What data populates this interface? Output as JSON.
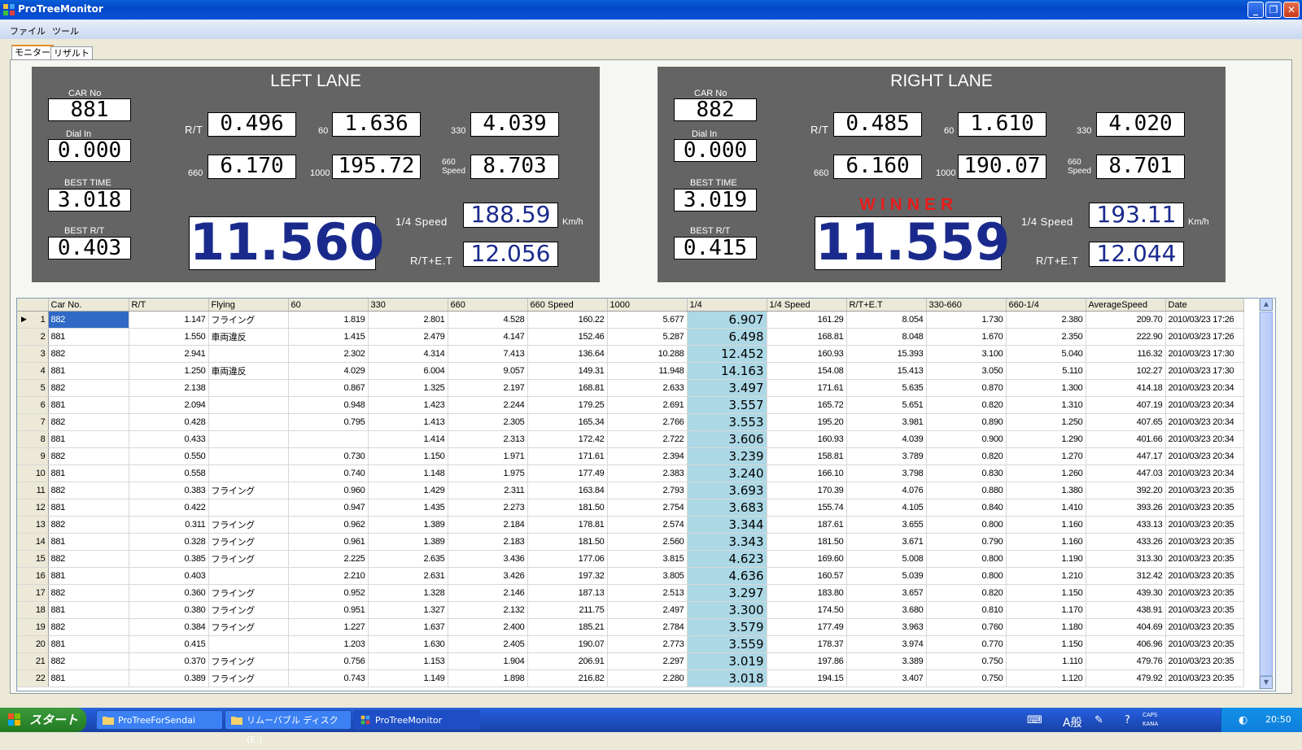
{
  "window": {
    "title": "ProTreeMonitor"
  },
  "menu": [
    "ファイル",
    "ツール"
  ],
  "tabs": [
    "モニター",
    "リザルト"
  ],
  "labels": {
    "car_no": "CAR No",
    "dial_in": "Dial In",
    "best_time": "BEST TIME",
    "best_rt": "BEST R/T",
    "rt": "R/T",
    "s60": "60",
    "s330": "330",
    "s660": "660",
    "s1000": "1000",
    "s660speed_1": "660",
    "s660speed_2": "Speed",
    "quarter_speed": "1/4 Speed",
    "kmh": "Km/h",
    "rt_et": "R/T+E.T"
  },
  "left_lane": {
    "title": "LEFT LANE",
    "car_no": "881",
    "dial_in": "0.000",
    "best_time": "3.018",
    "best_rt": "0.403",
    "rt": "0.496",
    "t60": "1.636",
    "t330": "4.039",
    "t660": "6.170",
    "t1000": "195.72",
    "t660speed": "8.703",
    "et": "11.560",
    "quarter_speed": "188.59",
    "rt_et": "12.056",
    "winner": ""
  },
  "right_lane": {
    "title": "RIGHT LANE",
    "car_no": "882",
    "dial_in": "0.000",
    "best_time": "3.019",
    "best_rt": "0.415",
    "rt": "0.485",
    "t60": "1.610",
    "t330": "4.020",
    "t660": "6.160",
    "t1000": "190.07",
    "t660speed": "8.701",
    "et": "11.559",
    "quarter_speed": "193.11",
    "rt_et": "12.044",
    "winner": "WINNER"
  },
  "grid": {
    "columns": [
      "Car No.",
      "R/T",
      "Flying",
      "60",
      "330",
      "660",
      "660 Speed",
      "1000",
      "1/4",
      "1/4 Speed",
      "R/T+E.T",
      "330-660",
      "660-1/4",
      "AverageSpeed",
      "Date"
    ],
    "rows": [
      [
        "1",
        "882",
        "1.147",
        "フライング",
        "1.819",
        "2.801",
        "4.528",
        "160.22",
        "5.677",
        "6.907",
        "161.29",
        "8.054",
        "1.730",
        "2.380",
        "209.70",
        "2010/03/23 17:26"
      ],
      [
        "2",
        "881",
        "1.550",
        "車両違反",
        "1.415",
        "2.479",
        "4.147",
        "152.46",
        "5.287",
        "6.498",
        "168.81",
        "8.048",
        "1.670",
        "2.350",
        "222.90",
        "2010/03/23 17:26"
      ],
      [
        "3",
        "882",
        "2.941",
        "",
        "2.302",
        "4.314",
        "7.413",
        "136.64",
        "10.288",
        "12.452",
        "160.93",
        "15.393",
        "3.100",
        "5.040",
        "116.32",
        "2010/03/23 17:30"
      ],
      [
        "4",
        "881",
        "1.250",
        "車両違反",
        "4.029",
        "6.004",
        "9.057",
        "149.31",
        "11.948",
        "14.163",
        "154.08",
        "15.413",
        "3.050",
        "5.110",
        "102.27",
        "2010/03/23 17:30"
      ],
      [
        "5",
        "882",
        "2.138",
        "",
        "0.867",
        "1.325",
        "2.197",
        "168.81",
        "2.633",
        "3.497",
        "171.61",
        "5.635",
        "0.870",
        "1.300",
        "414.18",
        "2010/03/23 20:34"
      ],
      [
        "6",
        "881",
        "2.094",
        "",
        "0.948",
        "1.423",
        "2.244",
        "179.25",
        "2.691",
        "3.557",
        "165.72",
        "5.651",
        "0.820",
        "1.310",
        "407.19",
        "2010/03/23 20:34"
      ],
      [
        "7",
        "882",
        "0.428",
        "",
        "0.795",
        "1.413",
        "2.305",
        "165.34",
        "2.766",
        "3.553",
        "195.20",
        "3.981",
        "0.890",
        "1.250",
        "407.65",
        "2010/03/23 20:34"
      ],
      [
        "8",
        "881",
        "0.433",
        "",
        "",
        "1.414",
        "2.313",
        "172.42",
        "2.722",
        "3.606",
        "160.93",
        "4.039",
        "0.900",
        "1.290",
        "401.66",
        "2010/03/23 20:34"
      ],
      [
        "9",
        "882",
        "0.550",
        "",
        "0.730",
        "1.150",
        "1.971",
        "171.61",
        "2.394",
        "3.239",
        "158.81",
        "3.789",
        "0.820",
        "1.270",
        "447.17",
        "2010/03/23 20:34"
      ],
      [
        "10",
        "881",
        "0.558",
        "",
        "0.740",
        "1.148",
        "1.975",
        "177.49",
        "2.383",
        "3.240",
        "166.10",
        "3.798",
        "0.830",
        "1.260",
        "447.03",
        "2010/03/23 20:34"
      ],
      [
        "11",
        "882",
        "0.383",
        "フライング",
        "0.960",
        "1.429",
        "2.311",
        "163.84",
        "2.793",
        "3.693",
        "170.39",
        "4.076",
        "0.880",
        "1.380",
        "392.20",
        "2010/03/23 20:35"
      ],
      [
        "12",
        "881",
        "0.422",
        "",
        "0.947",
        "1.435",
        "2.273",
        "181.50",
        "2.754",
        "3.683",
        "155.74",
        "4.105",
        "0.840",
        "1.410",
        "393.26",
        "2010/03/23 20:35"
      ],
      [
        "13",
        "882",
        "0.311",
        "フライング",
        "0.962",
        "1.389",
        "2.184",
        "178.81",
        "2.574",
        "3.344",
        "187.61",
        "3.655",
        "0.800",
        "1.160",
        "433.13",
        "2010/03/23 20:35"
      ],
      [
        "14",
        "881",
        "0.328",
        "フライング",
        "0.961",
        "1.389",
        "2.183",
        "181.50",
        "2.560",
        "3.343",
        "181.50",
        "3.671",
        "0.790",
        "1.160",
        "433.26",
        "2010/03/23 20:35"
      ],
      [
        "15",
        "882",
        "0.385",
        "フライング",
        "2.225",
        "2.635",
        "3.436",
        "177.06",
        "3.815",
        "4.623",
        "169.60",
        "5.008",
        "0.800",
        "1.190",
        "313.30",
        "2010/03/23 20:35"
      ],
      [
        "16",
        "881",
        "0.403",
        "",
        "2.210",
        "2.631",
        "3.426",
        "197.32",
        "3.805",
        "4.636",
        "160.57",
        "5.039",
        "0.800",
        "1.210",
        "312.42",
        "2010/03/23 20:35"
      ],
      [
        "17",
        "882",
        "0.360",
        "フライング",
        "0.952",
        "1.328",
        "2.146",
        "187.13",
        "2.513",
        "3.297",
        "183.80",
        "3.657",
        "0.820",
        "1.150",
        "439.30",
        "2010/03/23 20:35"
      ],
      [
        "18",
        "881",
        "0.380",
        "フライング",
        "0.951",
        "1.327",
        "2.132",
        "211.75",
        "2.497",
        "3.300",
        "174.50",
        "3.680",
        "0.810",
        "1.170",
        "438.91",
        "2010/03/23 20:35"
      ],
      [
        "19",
        "882",
        "0.384",
        "フライング",
        "1.227",
        "1.637",
        "2.400",
        "185.21",
        "2.784",
        "3.579",
        "177.49",
        "3.963",
        "0.760",
        "1.180",
        "404.69",
        "2010/03/23 20:35"
      ],
      [
        "20",
        "881",
        "0.415",
        "",
        "1.203",
        "1.630",
        "2.405",
        "190.07",
        "2.773",
        "3.559",
        "178.37",
        "3.974",
        "0.770",
        "1.150",
        "406.96",
        "2010/03/23 20:35"
      ],
      [
        "21",
        "882",
        "0.370",
        "フライング",
        "0.756",
        "1.153",
        "1.904",
        "206.91",
        "2.297",
        "3.019",
        "197.86",
        "3.389",
        "0.750",
        "1.110",
        "479.76",
        "2010/03/23 20:35"
      ],
      [
        "22",
        "881",
        "0.389",
        "フライング",
        "0.743",
        "1.149",
        "1.898",
        "216.82",
        "2.280",
        "3.018",
        "194.15",
        "3.407",
        "0.750",
        "1.120",
        "479.92",
        "2010/03/23 20:35"
      ]
    ]
  },
  "taskbar": {
    "start": "スタート",
    "tasks": [
      "ProTreeForSendai",
      "リムーバブル ディスク (E:)",
      "ProTreeMonitor"
    ],
    "ime": "A般",
    "caps": "CAPS",
    "kana": "KANA",
    "clock": "20:50"
  }
}
